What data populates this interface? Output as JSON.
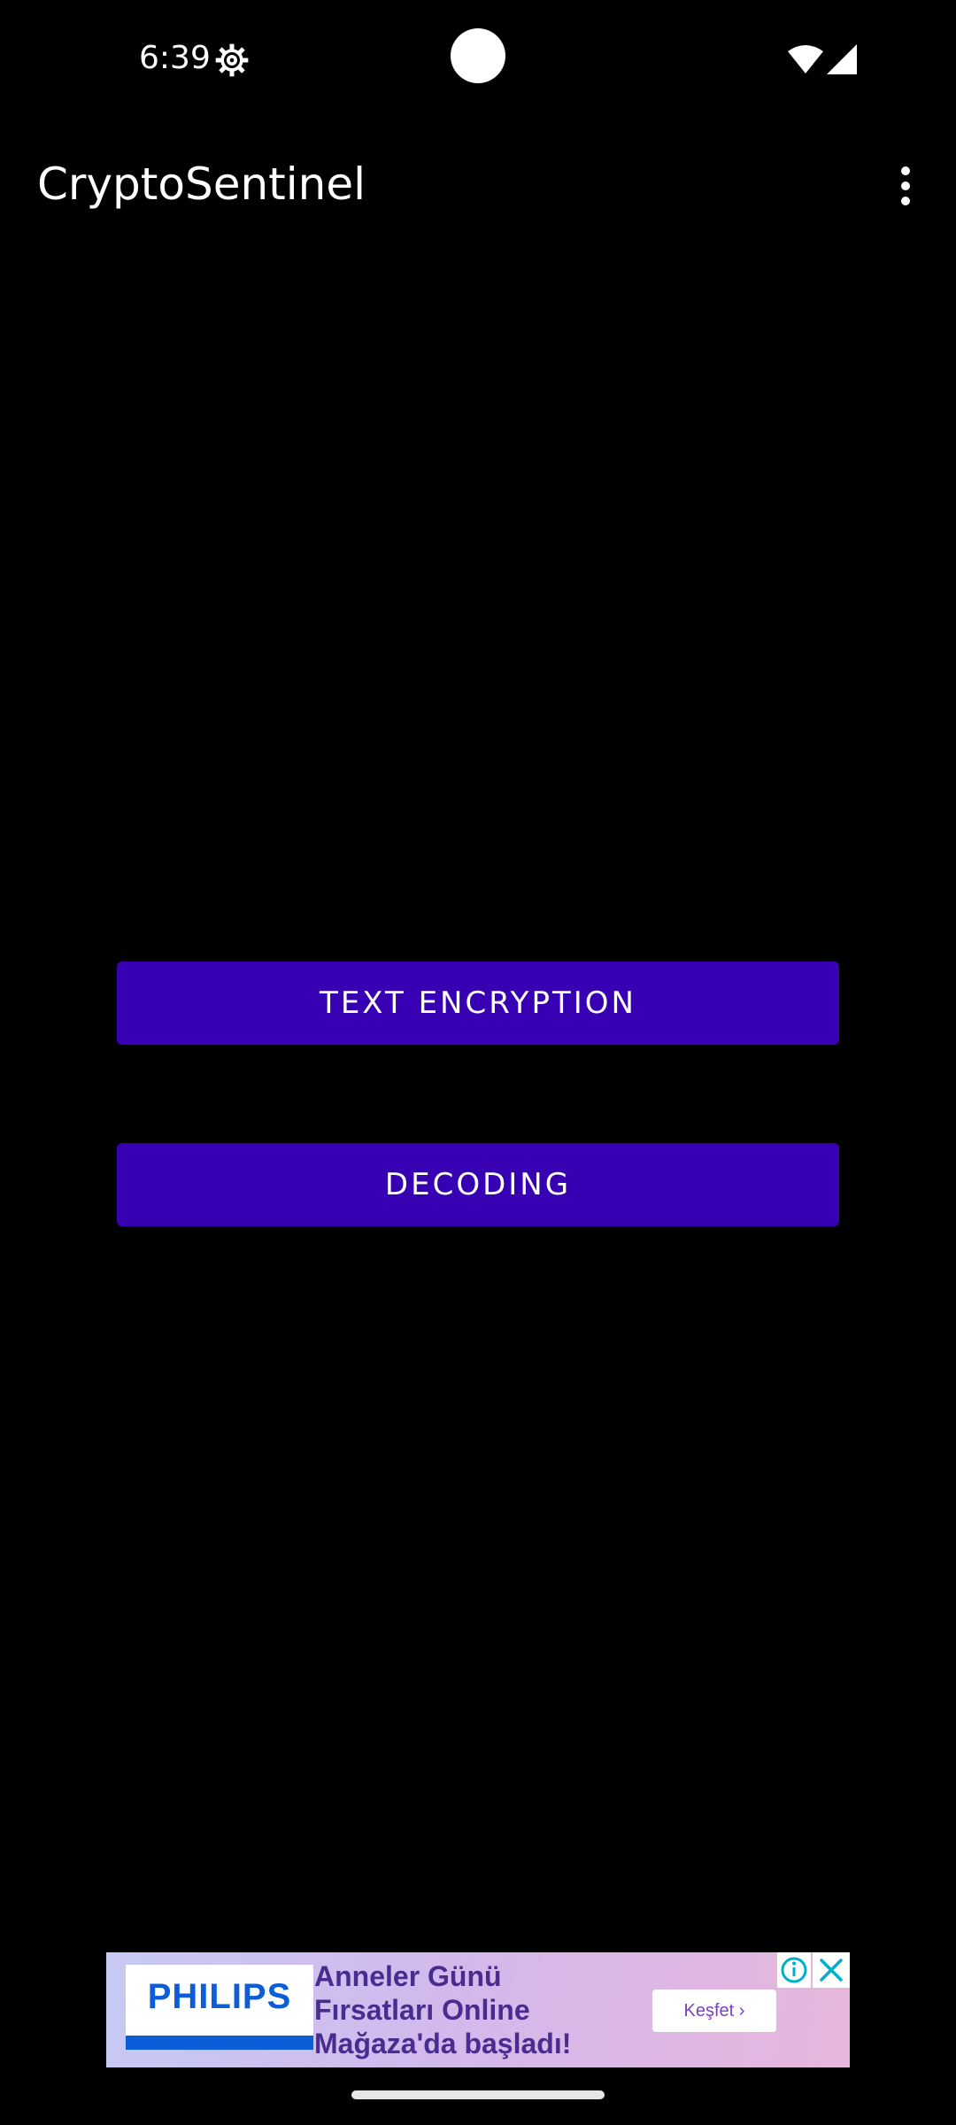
{
  "status_bar": {
    "time": "6:39",
    "icons": [
      "settings-gear-icon",
      "wifi-icon",
      "cellular-signal-icon"
    ]
  },
  "app_bar": {
    "title": "CryptoSentinel",
    "menu_icon": "more-vert-icon"
  },
  "main": {
    "encrypt_button_label": "TEXT ENCRYPTION",
    "decode_button_label": "DECODING"
  },
  "ad": {
    "brand": "PHILIPS",
    "headline_lines": [
      "Anneler Günü",
      "Fırsatları Online",
      "Mağaza'da başladı!"
    ],
    "cta_label": "Keşfet ›",
    "info_icon": "info-icon",
    "close_icon": "close-icon"
  },
  "colors": {
    "background": "#000000",
    "button": "#3700b3",
    "text": "#ffffff",
    "ad_brand": "#0b5ed7"
  }
}
